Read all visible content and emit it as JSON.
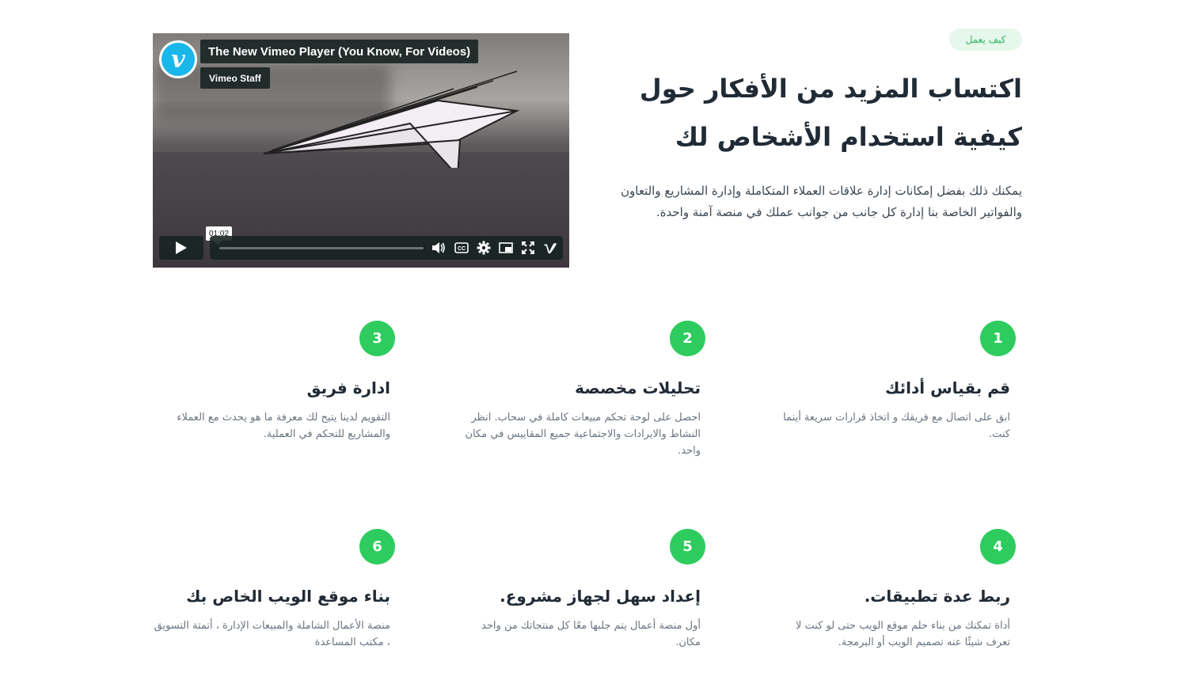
{
  "hero": {
    "badge": "كيف يعمل",
    "title_line1": "اكتساب المزيد من الأفكار حول",
    "title_line2": "كيفية استخدام الأشخاص لك",
    "description": "يمكنك ذلك بفضل إمكانات إدارة علاقات العملاء المتكاملة وإدارة المشاريع والتعاون والفواتير الخاصة بنا إدارة كل جانب من جوانب عملك في منصة آمنة واحدة."
  },
  "video": {
    "title": "The New Vimeo Player (You Know, For Videos)",
    "owner": "Vimeo Staff",
    "timecode": "01:02",
    "logo_letter": "v",
    "progress_fraction": 0,
    "icons": [
      "play-icon",
      "volume-icon",
      "captions-icon",
      "settings-icon",
      "pip-icon",
      "fullscreen-icon",
      "vimeo-icon"
    ]
  },
  "features": [
    {
      "number": "1",
      "title": "قم بقياس أدائك",
      "description": "ابق على اتصال مع فريقك و اتخاذ قرارات سريعة أينما كنت."
    },
    {
      "number": "2",
      "title": "تحليلات مخصصة",
      "description": "احصل على لوحة تحكم مبيعات كاملة في سحاب. انظر النشاط والايرادات والاجتماعية جميع المقاييس في مكان واحد."
    },
    {
      "number": "3",
      "title": "ادارة فريق",
      "description": "التقويم لدينا يتيح لك معرفة ما هو يحدث مع العملاء والمشاريع للتحكم في العملية."
    },
    {
      "number": "4",
      "title": "ربط عدة تطبيقات.",
      "description": "أداة تمكنك من بناء حلم موقع الويب حتى لو كنت لا تعرف شيئًا عنه تصميم الويب أو البرمجة."
    },
    {
      "number": "5",
      "title": "إعداد سهل لجهاز مشروع.",
      "description": "أول منصة أعمال يتم جلبها معًا كل منتجاتك من واحد مكان."
    },
    {
      "number": "6",
      "title": "بناء موقع الويب الخاص بك",
      "description": "منصة الأعمال الشاملة والمبيعات الإدارة ، أتمتة التسويق ، مكتب المساعدة"
    }
  ],
  "colors": {
    "accent": "#2ecc5e",
    "badge_bg": "#e6f7ec",
    "badge_text": "#2fb45f",
    "vimeo_blue": "#1ab7ea"
  }
}
